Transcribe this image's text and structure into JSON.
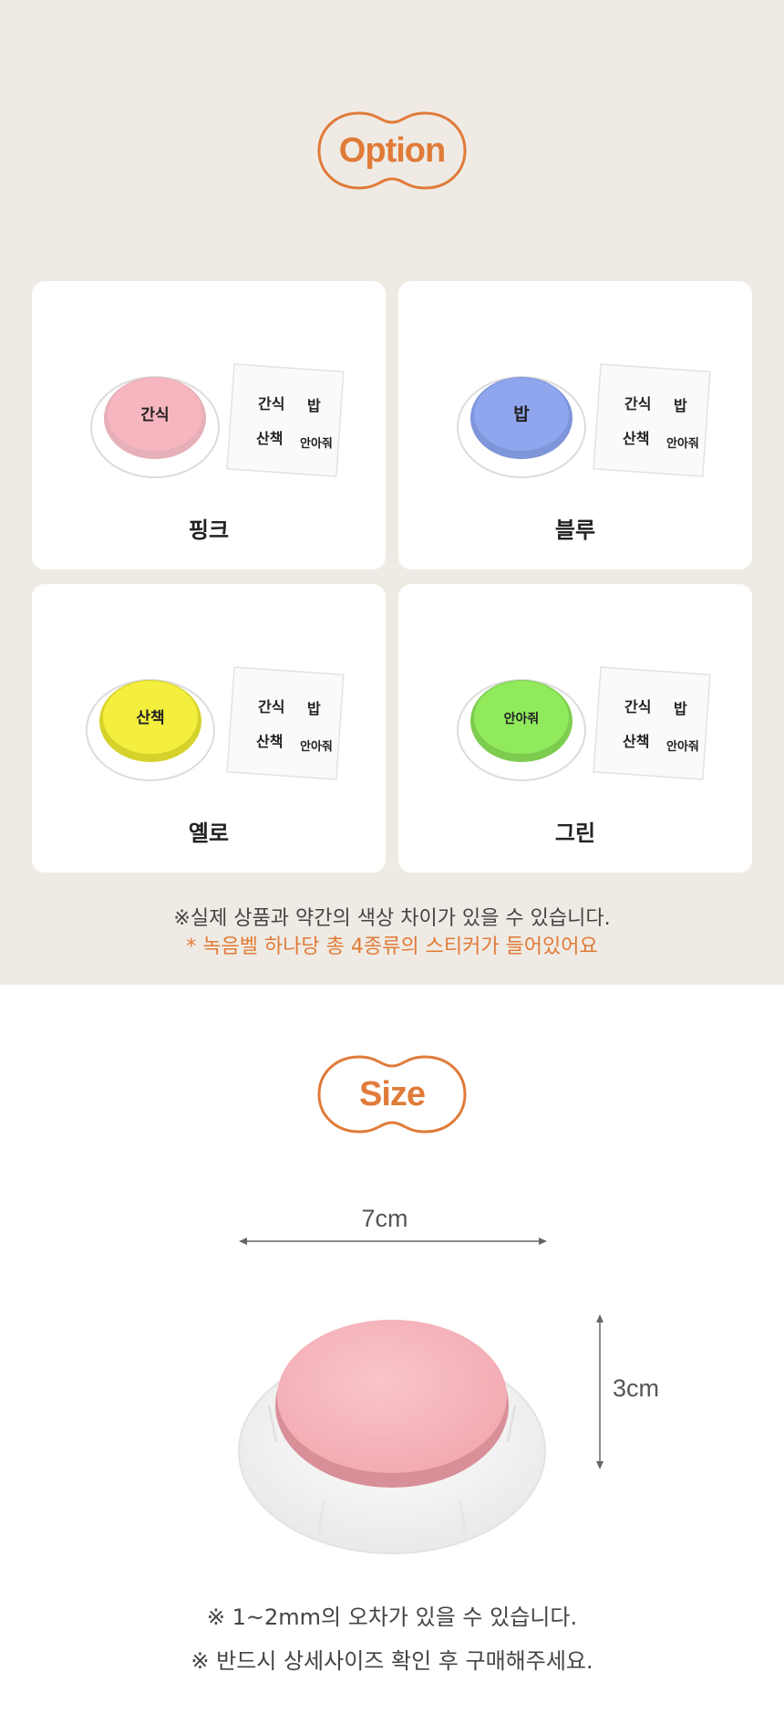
{
  "option_section": {
    "title": "Option",
    "cards": [
      {
        "label": "핑크",
        "button_color": "#f7b6bf",
        "button_text": "간식"
      },
      {
        "label": "블루",
        "button_color": "#8fa6ef",
        "button_text": "밥"
      },
      {
        "label": "옐로",
        "button_color": "#f4ef3e",
        "button_text": "산책"
      },
      {
        "label": "그린",
        "button_color": "#90ea5c",
        "button_text": "안아줘"
      }
    ],
    "sticker_labels": [
      "간식",
      "밥",
      "산책",
      "안아줘"
    ],
    "note_gray": "※실제 상품과 약간의 색상 차이가 있을 수 있습니다.",
    "note_orange": "* 녹음벨 하나당 총 4종류의 스티커가 들어있어요"
  },
  "size_section": {
    "title": "Size",
    "width_label": "7cm",
    "height_label": "3cm",
    "notes": [
      "※ 1~2mm의 오차가 있을 수 있습니다.",
      "※ 반드시 상세사이즈 확인 후 구매해주세요."
    ]
  },
  "colors": {
    "accent": "#e07b39",
    "option_bg": "#efebe4"
  }
}
